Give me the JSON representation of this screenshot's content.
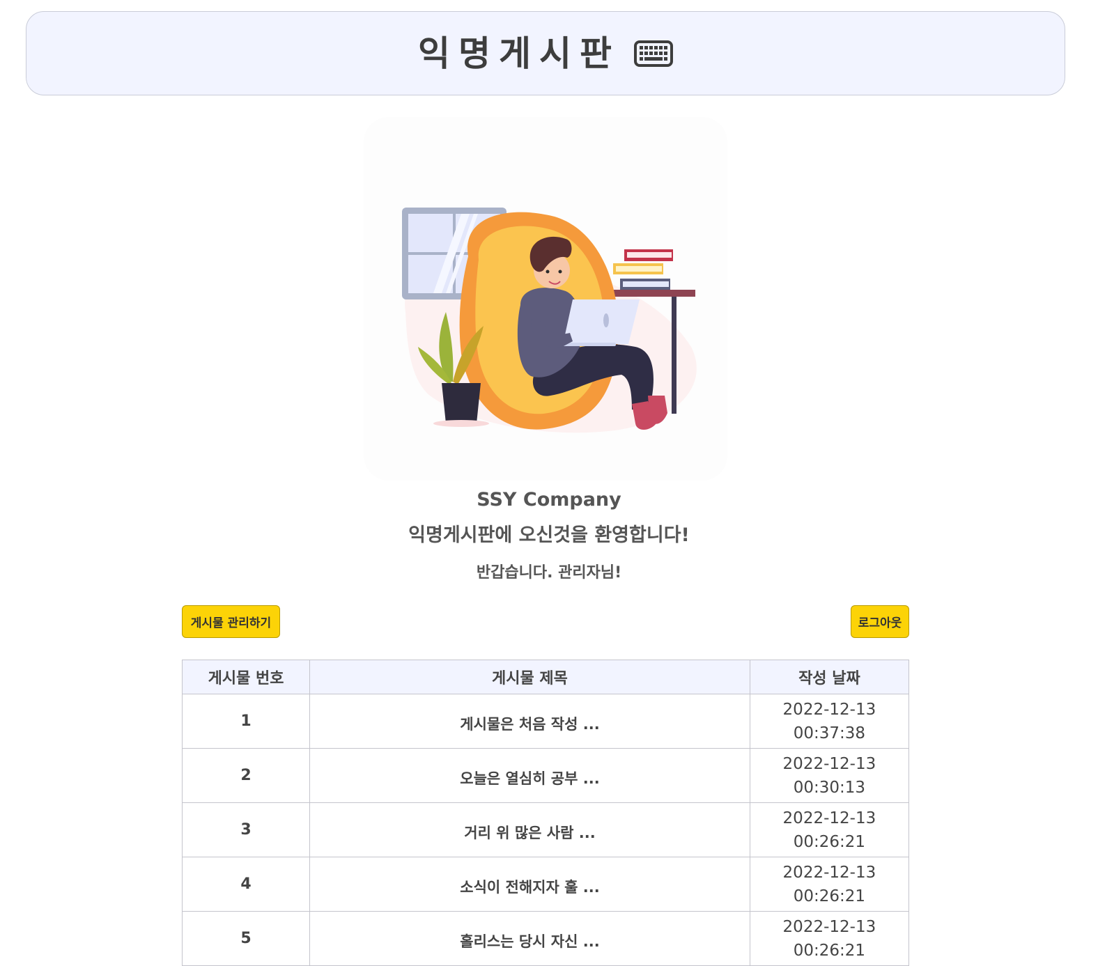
{
  "header": {
    "title": "익명게시판",
    "icon": "keyboard-icon"
  },
  "intro": {
    "company": "SSY Company",
    "welcome": "익명게시판에 오신것을 환영합니다!",
    "greeting": "반갑습니다. 관리자님!"
  },
  "actions": {
    "manage_label": "게시물 관리하기",
    "logout_label": "로그아웃"
  },
  "table": {
    "columns": [
      "게시물 번호",
      "게시물 제목",
      "작성 날짜"
    ],
    "rows": [
      {
        "no": "1",
        "title": "게시물은 처음 작성 ...",
        "date": "2022-12-13",
        "time": "00:37:38"
      },
      {
        "no": "2",
        "title": "오늘은 열심히 공부 ...",
        "date": "2022-12-13",
        "time": "00:30:13"
      },
      {
        "no": "3",
        "title": "거리 위 많은 사람 ...",
        "date": "2022-12-13",
        "time": "00:26:21"
      },
      {
        "no": "4",
        "title": "소식이 전해지자 훌 ...",
        "date": "2022-12-13",
        "time": "00:26:21"
      },
      {
        "no": "5",
        "title": "홀리스는 당시 자신 ...",
        "date": "2022-12-13",
        "time": "00:26:21"
      }
    ]
  },
  "colors": {
    "header_bg": "#f2f4ff",
    "button_yellow": "#fcd307",
    "text_dark": "#444444"
  }
}
